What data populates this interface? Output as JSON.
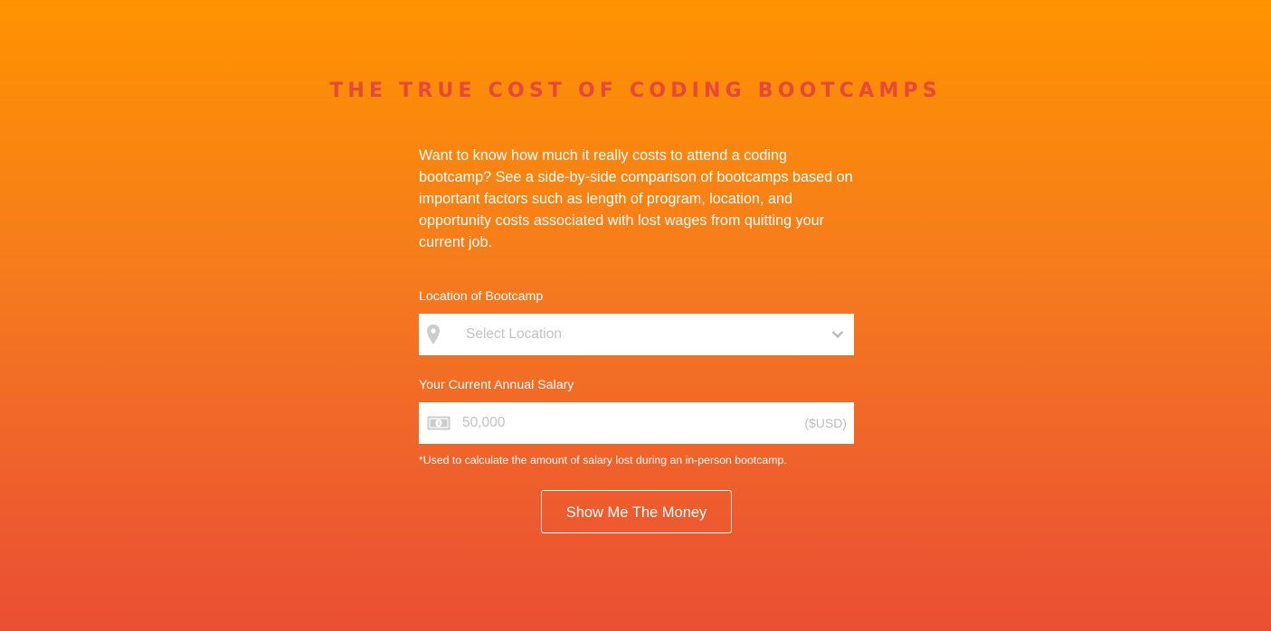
{
  "page": {
    "title": "THE TRUE COST OF CODING BOOTCAMPS",
    "intro": "Want to know how much it really costs to attend a coding bootcamp? See a side-by-side comparison of bootcamps based on important factors such as length of program, location, and opportunity costs associated with lost wages from quitting your current job."
  },
  "form": {
    "location": {
      "label": "Location of Bootcamp",
      "placeholder": "Select Location",
      "icon": "map-pin-icon"
    },
    "salary": {
      "label": "Your Current Annual Salary",
      "placeholder": "50,000",
      "unit": "($USD)",
      "icon": "money-bill-icon",
      "note": "*Used to calculate the amount of salary lost during an in-person bootcamp."
    },
    "submit_label": "Show Me The Money"
  },
  "colors": {
    "gradient_top": "#ff9300",
    "gradient_bottom": "#ea4f33",
    "title": "#e8473a",
    "placeholder": "#c2c2c2",
    "icon": "#cccccc"
  }
}
